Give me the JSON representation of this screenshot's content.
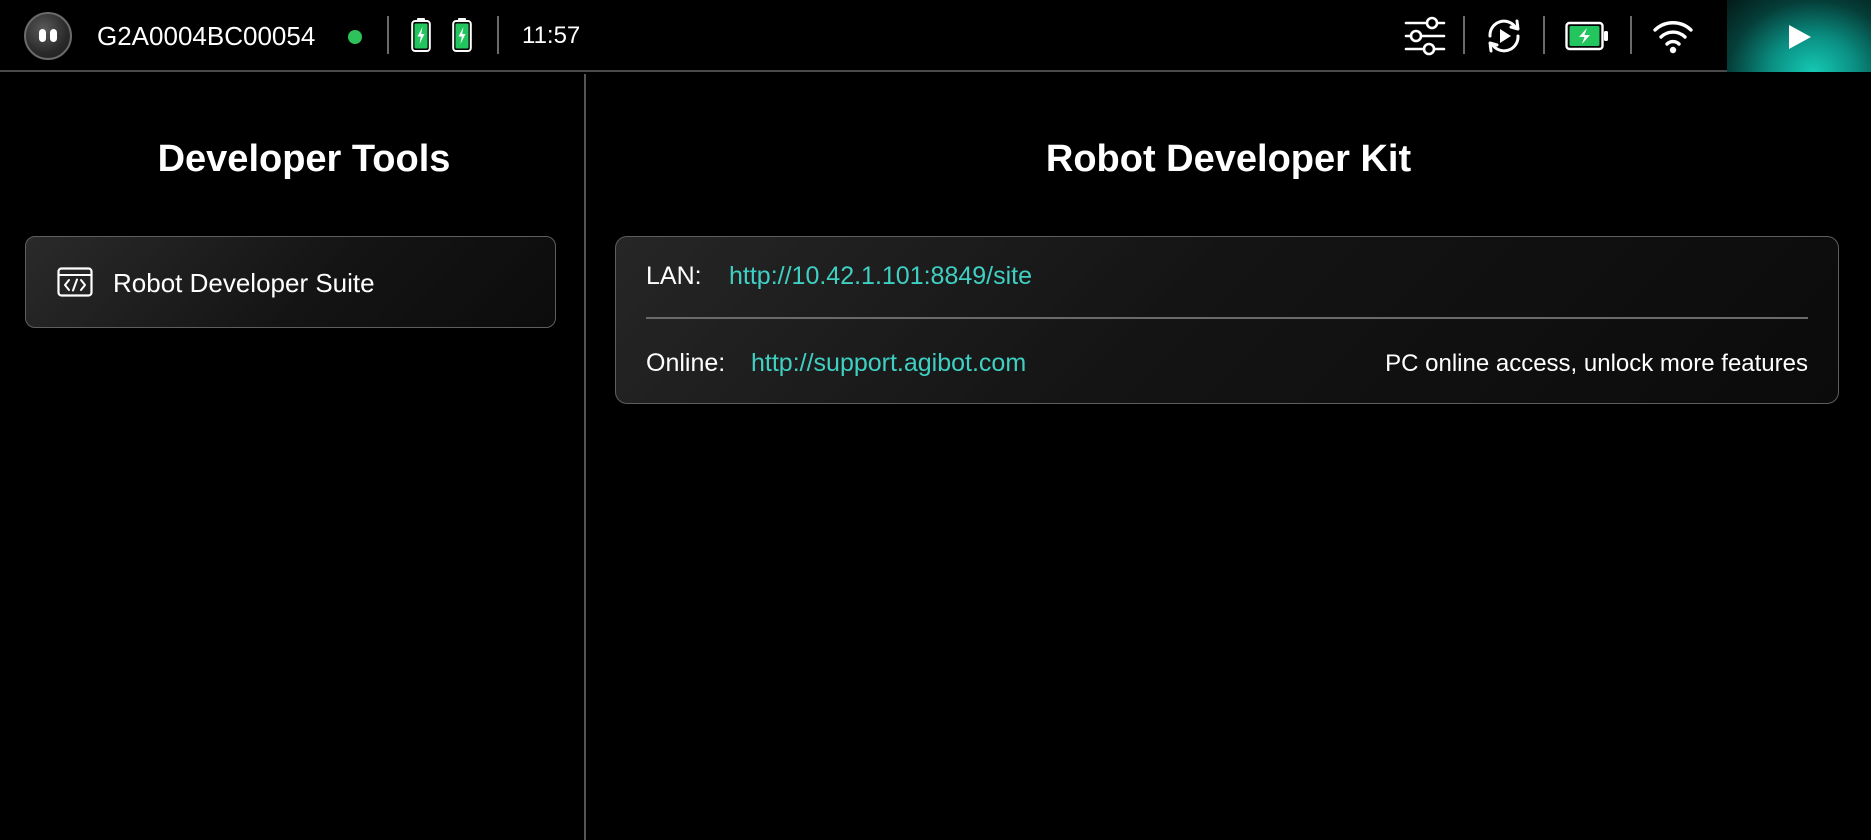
{
  "status_bar": {
    "device_id": "G2A0004BC00054",
    "connection_status_color": "#2ec35a",
    "time": "11:57",
    "icons": [
      "robot-avatar-icon",
      "battery-icon",
      "battery-icon",
      "sliders-icon",
      "replay-icon",
      "battery-charging-icon",
      "wifi-icon",
      "play-icon"
    ],
    "accent_color": "#16c9b5"
  },
  "left_panel": {
    "title": "Developer Tools",
    "items": [
      {
        "label": "Robot Developer Suite",
        "icon": "code-window-icon"
      }
    ]
  },
  "right_panel": {
    "title": "Robot Developer Kit",
    "lan": {
      "label": "LAN:",
      "url": "http://10.42.1.101:8849/site"
    },
    "online": {
      "label": "Online:",
      "url": "http://support.agibot.com",
      "note": "PC online access, unlock more features"
    },
    "link_color": "#3fd0c4"
  }
}
